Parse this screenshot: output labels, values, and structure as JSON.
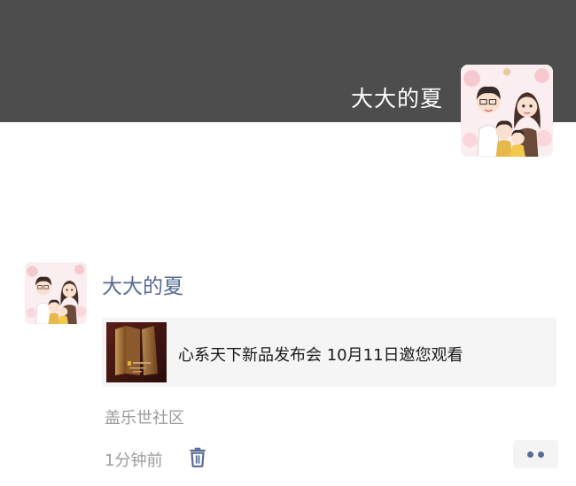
{
  "cover": {
    "user_name": "大大的夏",
    "avatar_icon": "family-cartoon-avatar-icon"
  },
  "post": {
    "author": "大大的夏",
    "avatar_icon": "family-cartoon-avatar-icon",
    "link": {
      "title": "心系天下新品发布会 10月11日邀您观看",
      "thumbnail_icon": "product-launch-thumbnail"
    },
    "location": "盖乐世社区",
    "time": "1分钟前",
    "delete_icon": "trash-icon",
    "more_icon": "more-dots-icon"
  },
  "colors": {
    "cover_bg": "#4d4d4d",
    "name_link": "#576b95",
    "meta_text": "#9b9b9b",
    "card_bg": "#f5f5f5"
  }
}
